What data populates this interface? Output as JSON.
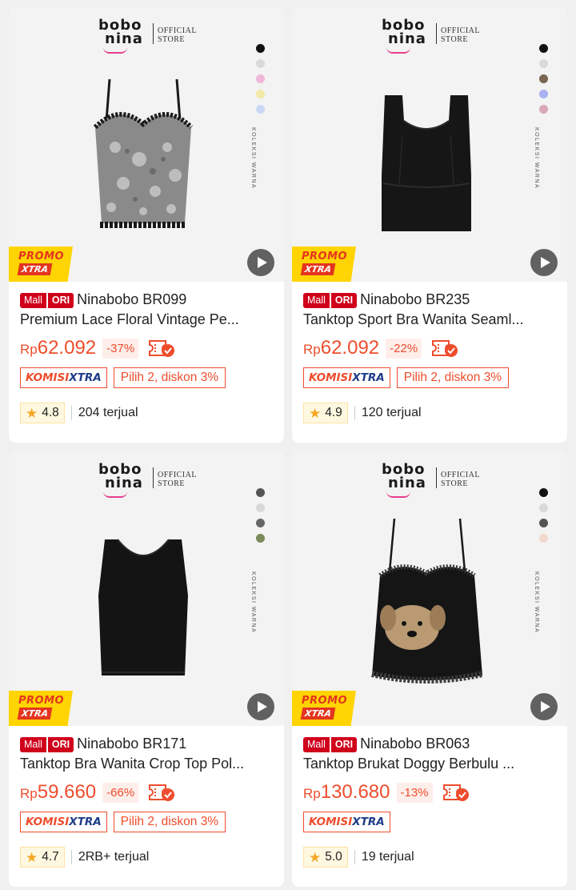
{
  "products": [
    {
      "mall": "Mall",
      "ori": "ORI",
      "title_line1": "Ninabobo BR099",
      "title_line2": "Premium Lace Floral Vintage Pe...",
      "price_currency": "Rp",
      "price_amount": "62.092",
      "discount": "-37%",
      "komisi": "KOMISI",
      "xtra": "XTRA",
      "promo_tag": "Pilih 2, diskon 3%",
      "rating": "4.8",
      "sold": "204 terjual",
      "color_dots": [
        "#111111",
        "#d9d9d9",
        "#f0b6d8",
        "#f3e9a6",
        "#c8d8f4"
      ],
      "garment_style": "lace",
      "brand_top": "bobo",
      "brand_bottom": "nina",
      "official": "OFFICIAL",
      "store": "STORE",
      "koleksi": "KOLEKSI WARNA",
      "promo1": "PROMO",
      "promo2": "XTRA"
    },
    {
      "mall": "Mall",
      "ori": "ORI",
      "title_line1": "Ninabobo BR235",
      "title_line2": "Tanktop Sport Bra Wanita Seaml...",
      "price_currency": "Rp",
      "price_amount": "62.092",
      "discount": "-22%",
      "komisi": "KOMISI",
      "xtra": "XTRA",
      "promo_tag": "Pilih 2, diskon 3%",
      "rating": "4.9",
      "sold": "120 terjual",
      "color_dots": [
        "#111111",
        "#d9d9d9",
        "#7a6650",
        "#aab0f0",
        "#d9a7b5"
      ],
      "garment_style": "sportbra",
      "brand_top": "bobo",
      "brand_bottom": "nina",
      "official": "OFFICIAL",
      "store": "STORE",
      "koleksi": "KOLEKSI WARNA",
      "promo1": "PROMO",
      "promo2": "XTRA"
    },
    {
      "mall": "Mall",
      "ori": "ORI",
      "title_line1": "Ninabobo BR171",
      "title_line2": "Tanktop Bra Wanita Crop Top Pol...",
      "price_currency": "Rp",
      "price_amount": "59.660",
      "discount": "-66%",
      "komisi": "KOMISI",
      "xtra": "XTRA",
      "promo_tag": "Pilih 2, diskon 3%",
      "rating": "4.7",
      "sold": "2RB+ terjual",
      "color_dots": [
        "#555555",
        "#d9d9d9",
        "#666666",
        "#7a8a5a"
      ],
      "garment_style": "crop",
      "brand_top": "bobo",
      "brand_bottom": "nina",
      "official": "OFFICIAL",
      "store": "STORE",
      "koleksi": "KOLEKSI WARNA",
      "promo1": "PROMO",
      "promo2": "XTRA"
    },
    {
      "mall": "Mall",
      "ori": "ORI",
      "title_line1": "Ninabobo BR063",
      "title_line2": "Tanktop Brukat Doggy Berbulu ...",
      "price_currency": "Rp",
      "price_amount": "130.680",
      "discount": "-13%",
      "komisi": "KOMISI",
      "xtra": "XTRA",
      "promo_tag": "",
      "rating": "5.0",
      "sold": "19 terjual",
      "color_dots": [
        "#111111",
        "#d9d9d9",
        "#555555",
        "#f0d8cc"
      ],
      "garment_style": "doggy",
      "brand_top": "bobo",
      "brand_bottom": "nina",
      "official": "OFFICIAL",
      "store": "STORE",
      "koleksi": "KOLEKSI WARNA",
      "promo1": "PROMO",
      "promo2": "XTRA"
    }
  ],
  "colors": {
    "accent": "#ee4d2d",
    "mall_red": "#d0011b",
    "promo_yellow": "#ffd400",
    "xtra_blue": "#1f3c88",
    "star": "#f5a623"
  },
  "icons": {
    "play": "play-icon",
    "star": "star-icon",
    "voucher": "voucher-check-icon"
  }
}
